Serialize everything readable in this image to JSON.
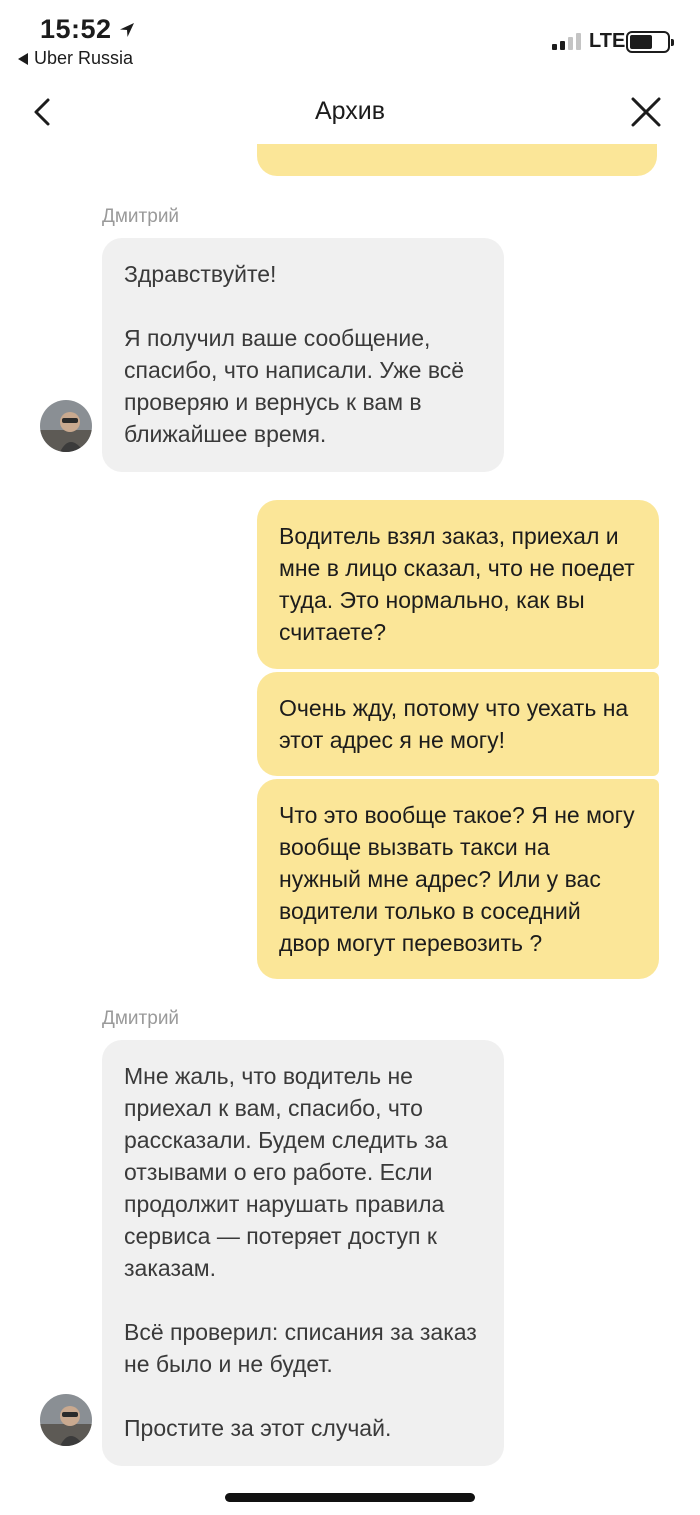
{
  "status_bar": {
    "time": "15:52",
    "back_app": "Uber Russia",
    "network": "LTE"
  },
  "nav": {
    "title": "Архив"
  },
  "messages": [
    {
      "sender": "Дмитрий",
      "direction": "incoming",
      "text": "Здравствуйте!\n\nЯ получил ваше сообщение, спасибо, что написали. Уже всё проверяю и вернусь к вам в ближайшее время."
    },
    {
      "direction": "outgoing",
      "text": "Водитель взял заказ, приехал и мне в лицо сказал, что не поедет туда. Это нормально, как вы считаете?"
    },
    {
      "direction": "outgoing",
      "text": "Очень жду, потому что уехать на этот адрес я не могу!"
    },
    {
      "direction": "outgoing",
      "text": "Что это вообще такое? Я не могу вообще вызвать такси на нужный мне адрес? Или у вас водители только в соседний двор могут перевозить ?"
    },
    {
      "sender": "Дмитрий",
      "direction": "incoming",
      "text": "Мне жаль, что водитель не приехал к вам, спасибо, что рассказали. Будем следить за отзывами о его работе. Если продолжит нарушать правила сервиса — потеряет доступ к заказам.\n\nВсё проверил: списания за заказ не было и не будет.\n\nПростите за этот случай."
    }
  ],
  "colors": {
    "incoming_bubble": "#f0f0f0",
    "outgoing_bubble": "#fbe698",
    "sender_label": "#9a9a9a"
  },
  "icons": {
    "back": "chevron-left-icon",
    "close": "close-icon",
    "location": "location-arrow-icon"
  }
}
